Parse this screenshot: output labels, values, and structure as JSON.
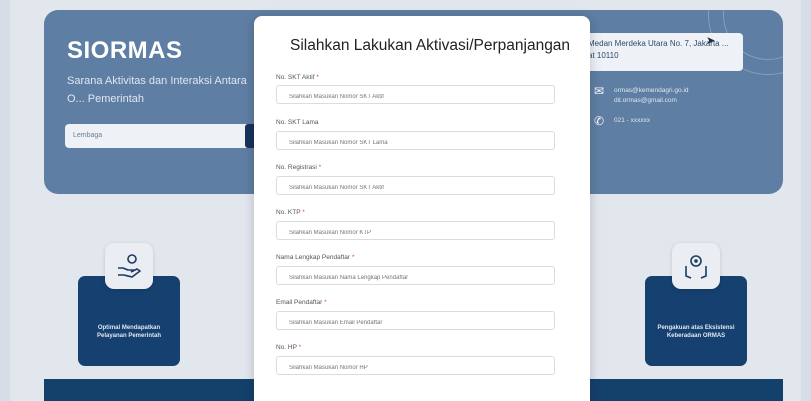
{
  "background": {
    "brand": "SIORMAS",
    "tagline": "Sarana Aktivitas dan Interaksi Antara O... Pemerintah",
    "search_label": "Lembaga",
    "address": "Medan Merdeka Utara No. 7, Jakarta ... at 10110",
    "email_lines": "ormas@kemendagri.go.id\ndit.ormas@gmail.com",
    "phone": "021 - xxxxxx",
    "feature_left": "Optimal Mendapatkan Pelayanan Pemerintah",
    "feature_right": "Pengakuan atas Eksistensi Keberadaan ORMAS",
    "colors": {
      "hero": "#5f7ea3",
      "navy": "#16406f"
    }
  },
  "modal": {
    "title": "Silahkan Lakukan Aktivasi/Perpanjangan",
    "fields": [
      {
        "label": "No. SKT Aktif",
        "required": true,
        "placeholder": "Silahkan Masukan Nomor SKT Aktif"
      },
      {
        "label": "No. SKT Lama",
        "required": false,
        "placeholder": "Silahkan Masukan Nomor SKT Lama"
      },
      {
        "label": "No. Registrasi",
        "required": true,
        "placeholder": "Silahkan Masukan Nomor SKT Aktif"
      },
      {
        "label": "No. KTP",
        "required": true,
        "placeholder": "Silahkan Masukan Nomor KTP"
      },
      {
        "label": "Nama Lengkap Pendaftar",
        "required": true,
        "placeholder": "Silahkan Masukan Nama Lengkap Pendaftar"
      },
      {
        "label": "Email Pendaftar",
        "required": true,
        "placeholder": "Silahkan Masukan Email Pendaftar"
      },
      {
        "label": "No. HP",
        "required": true,
        "placeholder": "Silahkan Masukan Nomor HP"
      }
    ]
  }
}
